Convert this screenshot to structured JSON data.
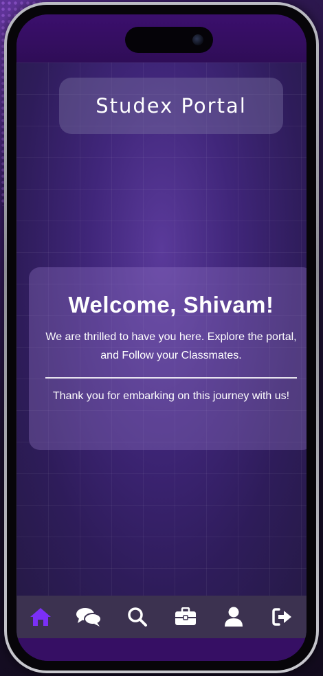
{
  "app": {
    "title": "Studex Portal"
  },
  "welcome": {
    "heading": "Welcome, Shivam!",
    "message": "We are thrilled to have you here. Explore the portal, and Follow your Classmates.",
    "thanks": "Thank you for embarking on this journey with us!"
  },
  "nav": {
    "active": "home",
    "items": [
      {
        "icon": "home-icon",
        "active": true
      },
      {
        "icon": "chat-icon",
        "active": false
      },
      {
        "icon": "search-icon",
        "active": false
      },
      {
        "icon": "briefcase-icon",
        "active": false
      },
      {
        "icon": "user-icon",
        "active": false
      },
      {
        "icon": "logout-icon",
        "active": false
      }
    ]
  },
  "colors": {
    "accent": "#7b2ff7",
    "nav_icon": "#ffffff",
    "nav_bar": "#3c3250",
    "screen_top": "#3b0f6d"
  }
}
